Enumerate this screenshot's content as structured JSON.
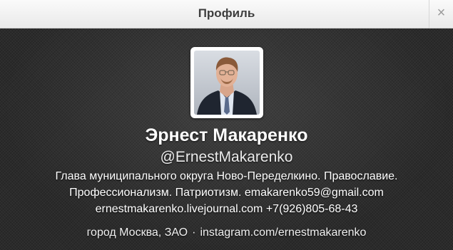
{
  "header": {
    "title": "Профиль",
    "close_glyph": "×"
  },
  "profile": {
    "name": "Эрнест Макаренко",
    "handle": "@ErnestMakarenko",
    "bio_lines": [
      "Глава муниципального округа Ново-Переделкино. Православие.",
      "Профессионализм. Патриотизм. emakarenko59@gmail.com",
      "ernestmakarenko.livejournal.com +7(926)805-68-43"
    ],
    "location": "город Москва, ЗАО",
    "separator": "·",
    "website": "instagram.com/ernestmakarenko"
  }
}
